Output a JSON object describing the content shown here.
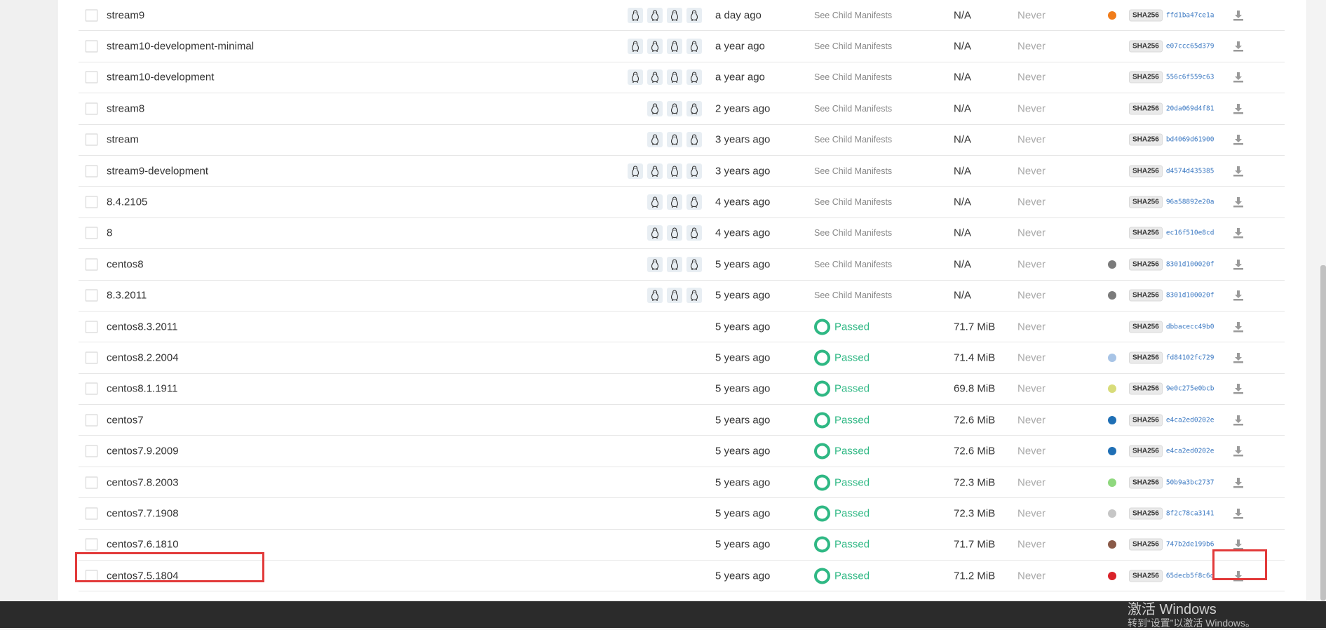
{
  "sha_badge": "SHA256",
  "rows": [
    {
      "tag": "stream9",
      "os_count": 4,
      "modified": "a day ago",
      "security": "See Child Manifests",
      "passed": false,
      "size": "N/A",
      "expires": "Never",
      "dot": "#f07c1a",
      "sha": "ffd1ba47ce1a"
    },
    {
      "tag": "stream10-development-minimal",
      "os_count": 4,
      "modified": "a year ago",
      "security": "See Child Manifests",
      "passed": false,
      "size": "N/A",
      "expires": "Never",
      "dot": "",
      "sha": "e07ccc65d379"
    },
    {
      "tag": "stream10-development",
      "os_count": 4,
      "modified": "a year ago",
      "security": "See Child Manifests",
      "passed": false,
      "size": "N/A",
      "expires": "Never",
      "dot": "",
      "sha": "556c6f559c63"
    },
    {
      "tag": "stream8",
      "os_count": 3,
      "modified": "2 years ago",
      "security": "See Child Manifests",
      "passed": false,
      "size": "N/A",
      "expires": "Never",
      "dot": "",
      "sha": "20da069d4f81"
    },
    {
      "tag": "stream",
      "os_count": 3,
      "modified": "3 years ago",
      "security": "See Child Manifests",
      "passed": false,
      "size": "N/A",
      "expires": "Never",
      "dot": "",
      "sha": "bd4069d61900"
    },
    {
      "tag": "stream9-development",
      "os_count": 4,
      "modified": "3 years ago",
      "security": "See Child Manifests",
      "passed": false,
      "size": "N/A",
      "expires": "Never",
      "dot": "",
      "sha": "d4574d435385"
    },
    {
      "tag": "8.4.2105",
      "os_count": 3,
      "modified": "4 years ago",
      "security": "See Child Manifests",
      "passed": false,
      "size": "N/A",
      "expires": "Never",
      "dot": "",
      "sha": "96a58892e20a"
    },
    {
      "tag": "8",
      "os_count": 3,
      "modified": "4 years ago",
      "security": "See Child Manifests",
      "passed": false,
      "size": "N/A",
      "expires": "Never",
      "dot": "",
      "sha": "ec16f510e8cd"
    },
    {
      "tag": "centos8",
      "os_count": 3,
      "modified": "5 years ago",
      "security": "See Child Manifests",
      "passed": false,
      "size": "N/A",
      "expires": "Never",
      "dot": "#7b7b7b",
      "sha": "8301d100020f"
    },
    {
      "tag": "8.3.2011",
      "os_count": 3,
      "modified": "5 years ago",
      "security": "See Child Manifests",
      "passed": false,
      "size": "N/A",
      "expires": "Never",
      "dot": "#7b7b7b",
      "sha": "8301d100020f"
    },
    {
      "tag": "centos8.3.2011",
      "os_count": 0,
      "modified": "5 years ago",
      "security": "Passed",
      "passed": true,
      "size": "71.7 MiB",
      "expires": "Never",
      "dot": "",
      "sha": "dbbacecc49b0"
    },
    {
      "tag": "centos8.2.2004",
      "os_count": 0,
      "modified": "5 years ago",
      "security": "Passed",
      "passed": true,
      "size": "71.4 MiB",
      "expires": "Never",
      "dot": "#a8c4e6",
      "sha": "fd84102fc729"
    },
    {
      "tag": "centos8.1.1911",
      "os_count": 0,
      "modified": "5 years ago",
      "security": "Passed",
      "passed": true,
      "size": "69.8 MiB",
      "expires": "Never",
      "dot": "#d8dc7a",
      "sha": "9e0c275e0bcb"
    },
    {
      "tag": "centos7",
      "os_count": 0,
      "modified": "5 years ago",
      "security": "Passed",
      "passed": true,
      "size": "72.6 MiB",
      "expires": "Never",
      "dot": "#1f6fb5",
      "sha": "e4ca2ed0202e"
    },
    {
      "tag": "centos7.9.2009",
      "os_count": 0,
      "modified": "5 years ago",
      "security": "Passed",
      "passed": true,
      "size": "72.6 MiB",
      "expires": "Never",
      "dot": "#1f6fb5",
      "sha": "e4ca2ed0202e"
    },
    {
      "tag": "centos7.8.2003",
      "os_count": 0,
      "modified": "5 years ago",
      "security": "Passed",
      "passed": true,
      "size": "72.3 MiB",
      "expires": "Never",
      "dot": "#8fd87e",
      "sha": "50b9a3bc2737"
    },
    {
      "tag": "centos7.7.1908",
      "os_count": 0,
      "modified": "5 years ago",
      "security": "Passed",
      "passed": true,
      "size": "72.3 MiB",
      "expires": "Never",
      "dot": "#c6c6c6",
      "sha": "8f2c78ca3141"
    },
    {
      "tag": "centos7.6.1810",
      "os_count": 0,
      "modified": "5 years ago",
      "security": "Passed",
      "passed": true,
      "size": "71.7 MiB",
      "expires": "Never",
      "dot": "#8a5a48",
      "sha": "747b2de199b6"
    },
    {
      "tag": "centos7.5.1804",
      "os_count": 0,
      "modified": "5 years ago",
      "security": "Passed",
      "passed": true,
      "size": "71.2 MiB",
      "expires": "Never",
      "dot": "#d9232a",
      "sha": "65decb5f8c6d"
    }
  ],
  "watermark": {
    "title": "激活 Windows",
    "subtitle": "转到“设置”以激活 Windows。"
  },
  "colors": {
    "passed": "#2fb884",
    "highlight": "#e23a3a"
  }
}
